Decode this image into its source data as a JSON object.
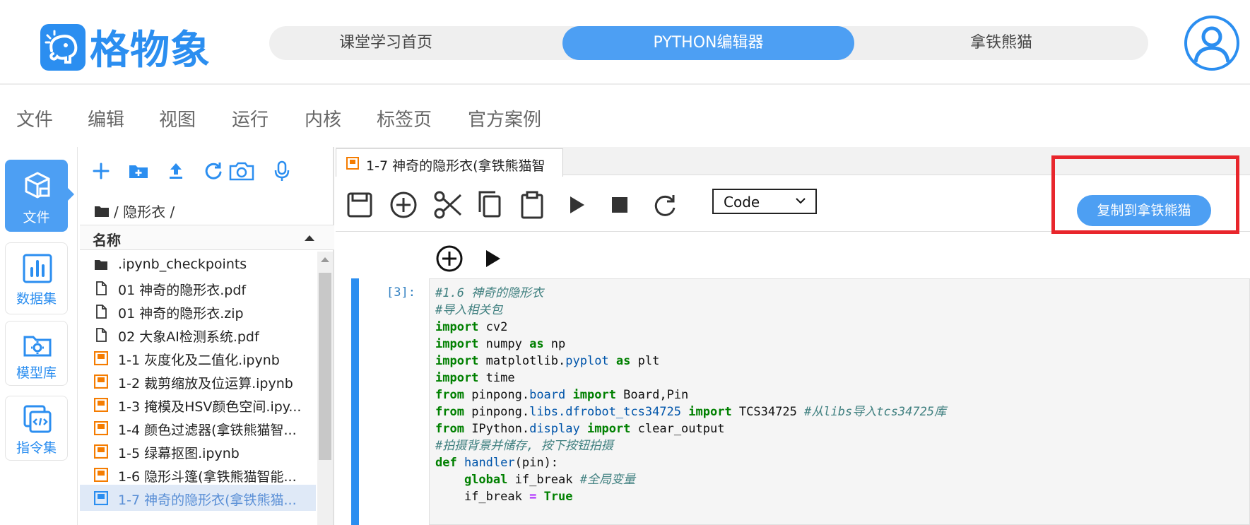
{
  "app": {
    "brand": "格物象",
    "nav": [
      "课堂学习首页",
      "PYTHON编辑器",
      "拿铁熊猫"
    ],
    "nav_active": 1
  },
  "menubar": [
    "文件",
    "编辑",
    "视图",
    "运行",
    "内核",
    "标签页",
    "官方案例"
  ],
  "rail": [
    {
      "label": "文件",
      "icon": "cube-icon",
      "active": true
    },
    {
      "label": "数据集",
      "icon": "bar-chart-icon",
      "active": false
    },
    {
      "label": "模型库",
      "icon": "folder-gear-icon",
      "active": false
    },
    {
      "label": "指令集",
      "icon": "code-pages-icon",
      "active": false
    }
  ],
  "filebrowser": {
    "toolbar_icons": [
      "plus-icon",
      "new-folder-icon",
      "upload-icon",
      "refresh-icon",
      "camera-icon",
      "microphone-icon"
    ],
    "breadcrumb": "/ 隐形衣 /",
    "column_name": "名称",
    "files": [
      {
        "name": ".ipynb_checkpoints",
        "type": "folder"
      },
      {
        "name": "01 神奇的隐形衣.pdf",
        "type": "file"
      },
      {
        "name": "01 神奇的隐形衣.zip",
        "type": "file"
      },
      {
        "name": "02 大象AI检测系统.pdf",
        "type": "file"
      },
      {
        "name": "1-1 灰度化及二值化.ipynb",
        "type": "notebook"
      },
      {
        "name": "1-2 裁剪缩放及位运算.ipynb",
        "type": "notebook"
      },
      {
        "name": "1-3 掩模及HSV颜色空间.ipy...",
        "type": "notebook"
      },
      {
        "name": "1-4 颜色过滤器(拿铁熊猫智...",
        "type": "notebook"
      },
      {
        "name": "1-5 绿幕抠图.ipynb",
        "type": "notebook"
      },
      {
        "name": "1-6 隐形斗篷(拿铁熊猫智能...",
        "type": "notebook"
      },
      {
        "name": "1-7 神奇的隐形衣(拿铁熊猫...",
        "type": "notebook-active"
      }
    ]
  },
  "editor": {
    "tab_title": "1-7 神奇的隐形衣(拿铁熊猫智",
    "toolbar_icons": [
      "save-icon",
      "add-cell-icon",
      "cut-icon",
      "copy-icon",
      "paste-icon",
      "run-icon",
      "stop-icon",
      "restart-icon"
    ],
    "cell_type": "Code",
    "copy_button": "复制到拿铁熊猫",
    "cell_prompt": "[3]:"
  }
}
